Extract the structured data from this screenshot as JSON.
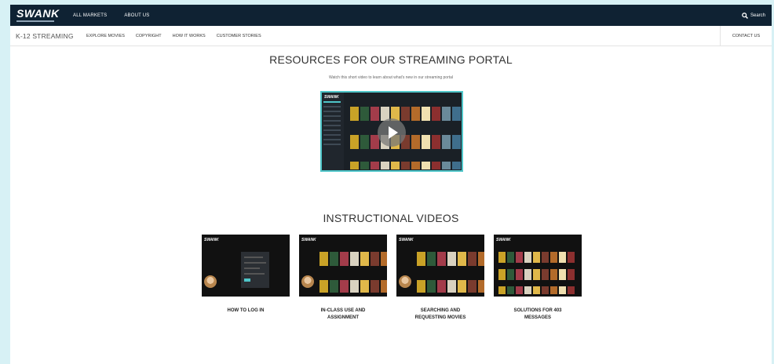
{
  "topbar": {
    "logo": "SWANK",
    "nav": [
      "ALL MARKETS",
      "ABOUT US"
    ],
    "search_label": "Search"
  },
  "subnav": {
    "portal_title": "K-12 STREAMING",
    "links": [
      "EXPLORE MOVIES",
      "COPYRIGHT",
      "HOW IT WORKS",
      "CUSTOMER STORIES"
    ],
    "contact": "CONTACT US"
  },
  "resources": {
    "title": "RESOURCES FOR OUR STREAMING PORTAL",
    "subtitle": "Watch this short video to learn about what's new in our streaming portal",
    "video_logo": "SWANK"
  },
  "instructional": {
    "title": "INSTRUCTIONAL VIDEOS",
    "videos": [
      {
        "label_line1": "HOW TO LOG IN",
        "label_line2": "",
        "logo": "SWANK"
      },
      {
        "label_line1": "IN-CLASS USE AND",
        "label_line2": "ASSIGNMENT",
        "logo": "SWANK"
      },
      {
        "label_line1": "SEARCHING AND",
        "label_line2": "REQUESTING MOVIES",
        "logo": "SWANK"
      },
      {
        "label_line1": "SOLUTIONS FOR 403",
        "label_line2": "MESSAGES",
        "logo": "SWANK"
      }
    ]
  },
  "colors": {
    "topbar_bg": "#0f2233",
    "accent": "#4fc6c9",
    "page_bg": "#d7f1f5"
  }
}
